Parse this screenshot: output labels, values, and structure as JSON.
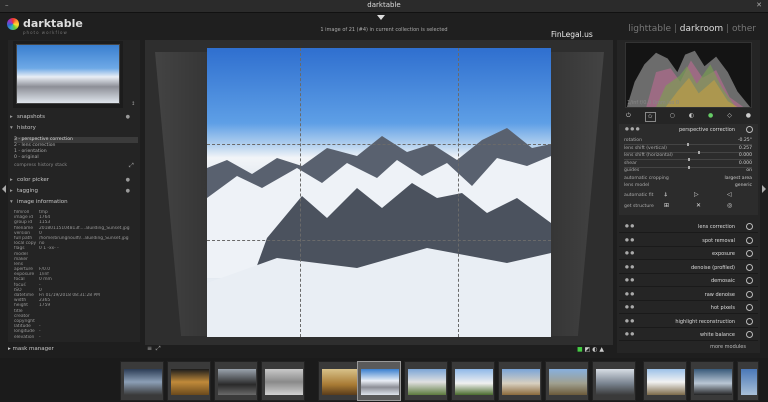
{
  "window": {
    "title": "darktable"
  },
  "brand": {
    "name": "darktable",
    "subtitle": "photo workflow"
  },
  "status": "1 image of 21 (#4) in current collection is selected",
  "views": {
    "lighttable": "lighttable",
    "darkroom": "darkroom",
    "other": "other",
    "sep": "|"
  },
  "watermark": "FinLegal.us",
  "left_panel": {
    "snapshots": "snapshots",
    "history": "history",
    "history_items": [
      "3 - perspective correction",
      "2 - lens correction",
      "1 - orientation",
      "0 - original"
    ],
    "compress": "compress history stack",
    "color_picker": "color picker",
    "tagging": "tagging",
    "image_information": "image information",
    "info_rows": [
      {
        "k": "filmroll",
        "v": "tmp"
      },
      {
        "k": "image id",
        "v": "1764"
      },
      {
        "k": "group id",
        "v": "1153"
      },
      {
        "k": "filename",
        "v": "20180115104813f.....Building_Sunset.jpg"
      },
      {
        "k": "version",
        "v": "0"
      },
      {
        "k": "full path",
        "v": "/home/brungnoulfi/...Building_Sunset.jpg"
      },
      {
        "k": "local copy",
        "v": "no"
      },
      {
        "k": "flags",
        "v": "0 1 -xx- -"
      },
      {
        "k": "model",
        "v": ""
      },
      {
        "k": "maker",
        "v": ""
      },
      {
        "k": "lens",
        "v": ""
      },
      {
        "k": "aperture",
        "v": "F/0.0"
      },
      {
        "k": "exposure",
        "v": "1/inf"
      },
      {
        "k": "focal length",
        "v": "0 mm"
      },
      {
        "k": "focus distance",
        "v": "-"
      },
      {
        "k": "ISO",
        "v": "0"
      },
      {
        "k": "datetime",
        "v": "Fri 01/19/2018 08:31:28 PM"
      },
      {
        "k": "width",
        "v": "2365"
      },
      {
        "k": "height",
        "v": "1759"
      },
      {
        "k": "title",
        "v": ""
      },
      {
        "k": "creator",
        "v": ""
      },
      {
        "k": "copyright",
        "v": ""
      },
      {
        "k": "latitude",
        "v": "-"
      },
      {
        "k": "longitude",
        "v": "-"
      },
      {
        "k": "elevation",
        "v": "-"
      }
    ],
    "mask_manager": "mask manager"
  },
  "right_panel": {
    "exif": "1/inf f/0.0 0mm iso 0",
    "perspective": {
      "title": "perspective correction",
      "rows": [
        {
          "k": "rotation",
          "v": "-0.25°",
          "pos": 0.49
        },
        {
          "k": "lens shift (vertical)",
          "v": "0.257",
          "pos": 0.58
        },
        {
          "k": "lens shift (horizontal)",
          "v": "0.000",
          "pos": 0.5
        },
        {
          "k": "shear",
          "v": "0.000",
          "pos": 0.5
        },
        {
          "k": "guides",
          "v": "on",
          "pos": null
        },
        {
          "k": "automatic cropping",
          "v": "largest area",
          "pos": null
        },
        {
          "k": "lens model",
          "v": "generic",
          "pos": null
        }
      ],
      "auto_fit": "automatic fit",
      "get_structure": "get structure"
    },
    "modules": [
      "lens correction",
      "spot removal",
      "exposure",
      "denoise (profiled)",
      "demosaic",
      "raw denoise",
      "hot pixels",
      "highlight reconstruction",
      "white balance"
    ],
    "more_modules": "more modules"
  },
  "icons": [
    "power-icon",
    "star-icon",
    "circle-icon",
    "half-circle-icon",
    "color-icon",
    "drop-icon",
    "gear-icon"
  ]
}
